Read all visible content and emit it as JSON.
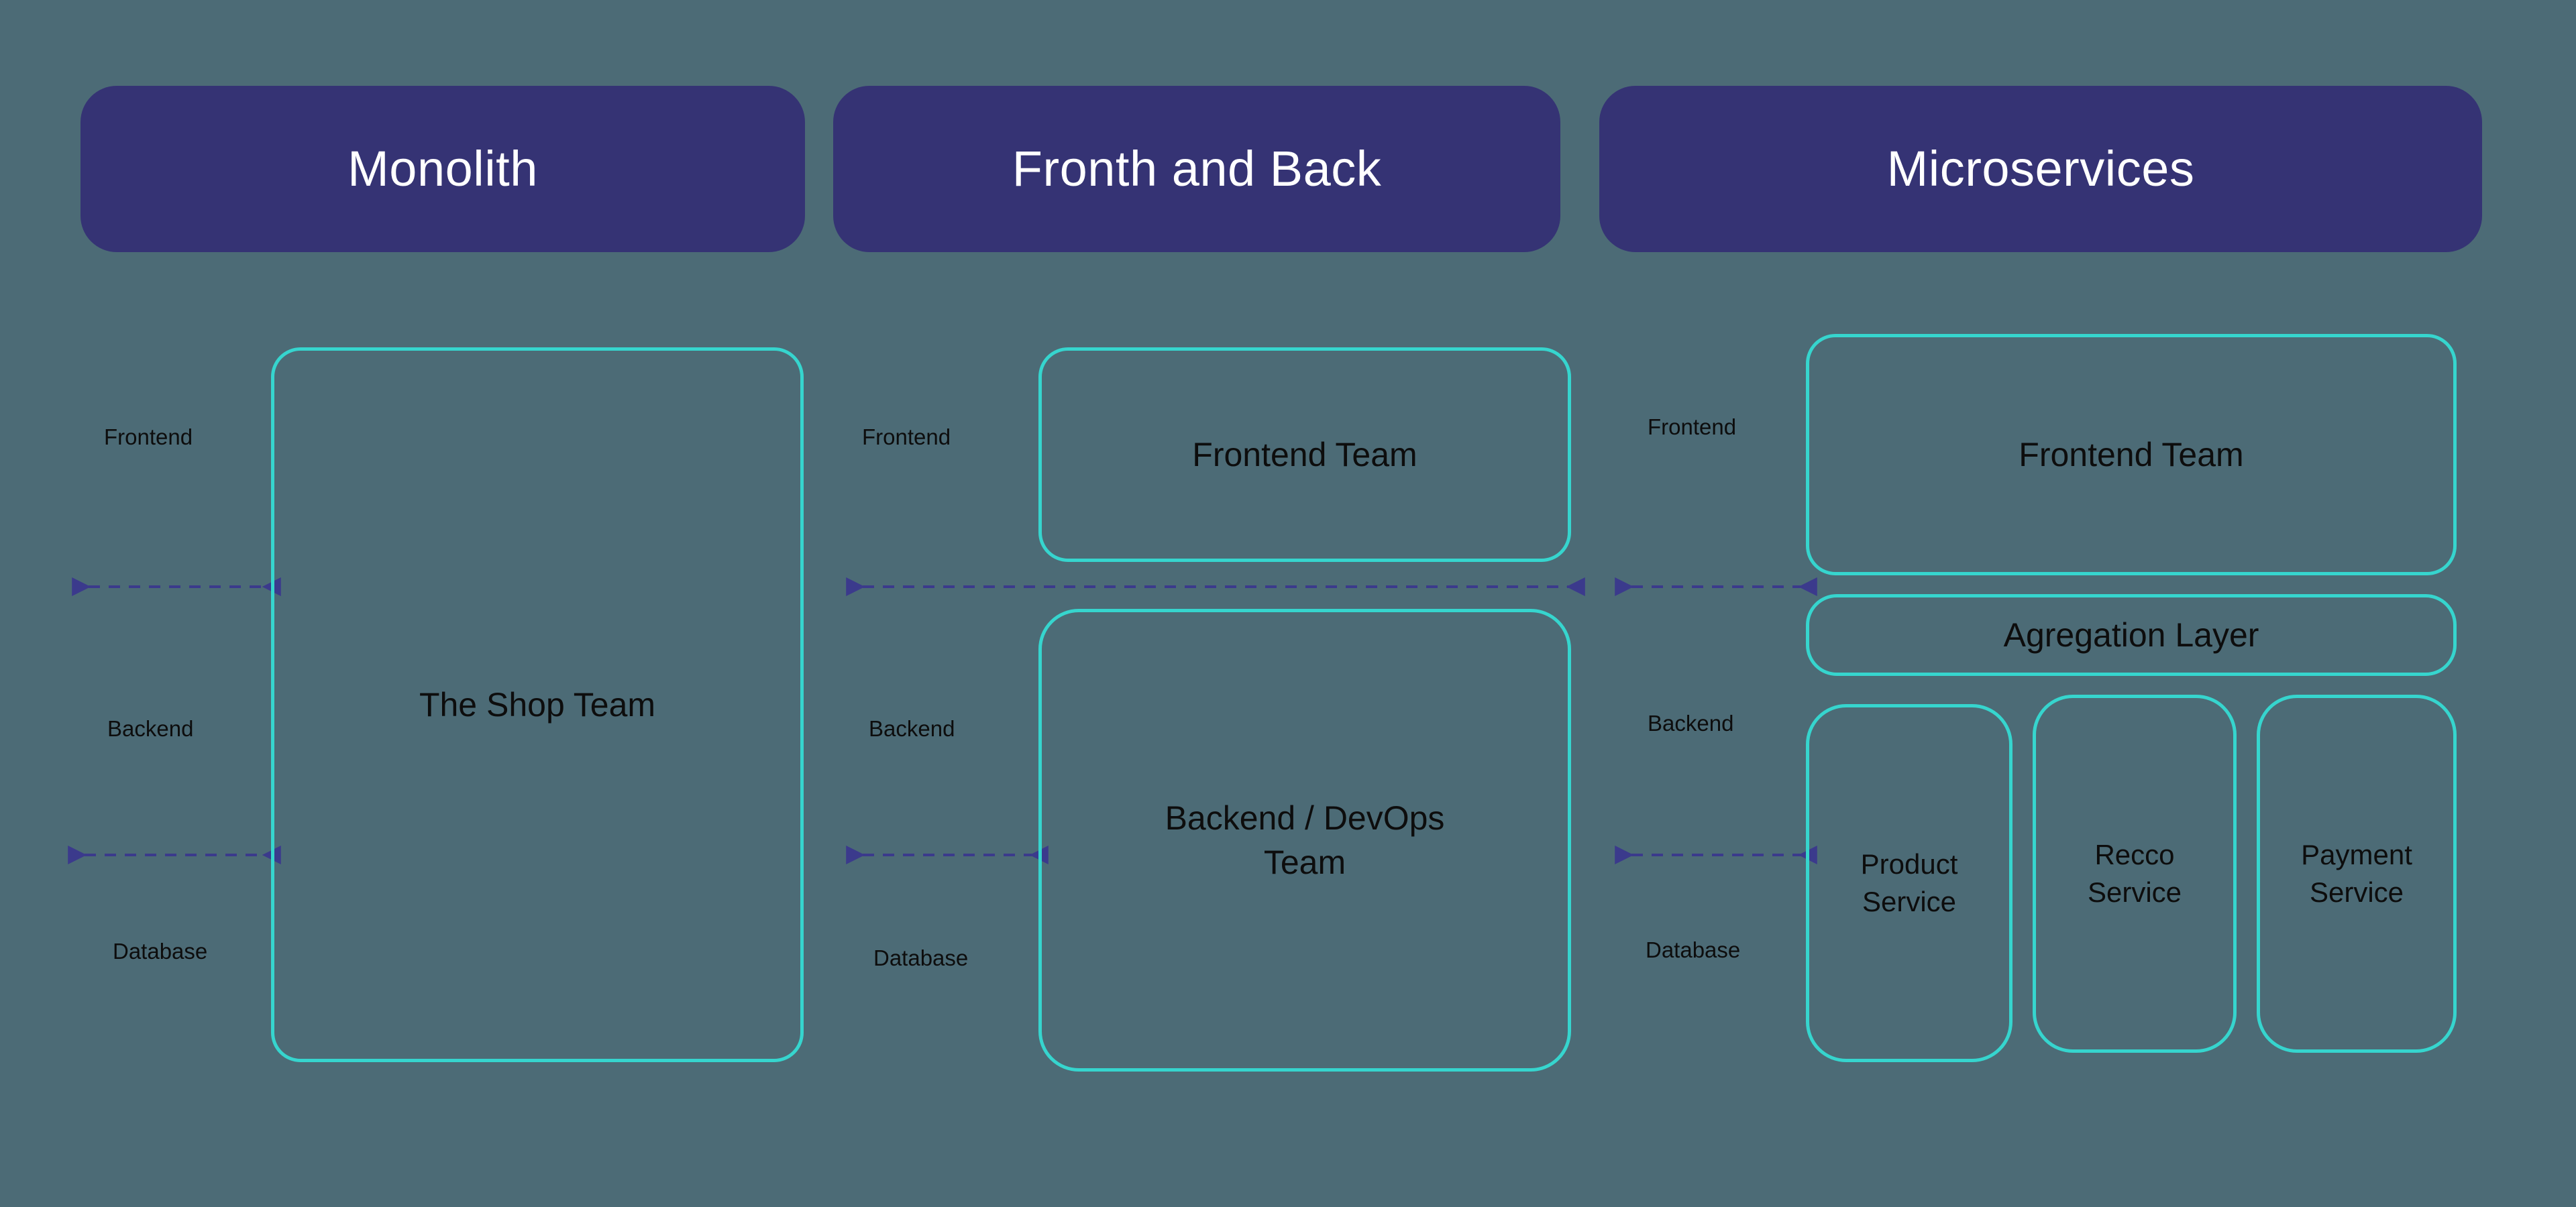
{
  "diagram": {
    "title_bands": [
      {
        "label": "Monolith"
      },
      {
        "label": "Fronth and Back"
      },
      {
        "label": "Microservices"
      }
    ],
    "axis_labels": {
      "frontend": "Frontend",
      "backend": "Backend",
      "database": "Database"
    },
    "columns": [
      {
        "name": "monolith",
        "header": "Monolith",
        "axis": {
          "frontend": "Frontend",
          "backend": "Backend",
          "database": "Database"
        },
        "boxes": [
          {
            "label": "The Shop Team",
            "spans": [
              "frontend",
              "backend",
              "database"
            ]
          }
        ]
      },
      {
        "name": "fronth-and-back",
        "header": "Fronth and Back",
        "axis": {
          "frontend": "Frontend",
          "backend": "Backend",
          "database": "Database"
        },
        "boxes": [
          {
            "label": "Frontend Team",
            "spans": [
              "frontend"
            ]
          },
          {
            "label": "Backend / DevOps Team",
            "spans": [
              "backend",
              "database"
            ]
          }
        ]
      },
      {
        "name": "microservices",
        "header": "Microservices",
        "axis": {
          "frontend": "Frontend",
          "backend": "Backend",
          "database": "Database"
        },
        "boxes": [
          {
            "label": "Frontend Team",
            "spans": [
              "frontend"
            ]
          },
          {
            "label": "Agregation Layer",
            "spans": [
              "boundary"
            ]
          },
          {
            "label": "Product Service",
            "spans": [
              "backend",
              "database"
            ]
          },
          {
            "label": "Recco Service",
            "spans": [
              "backend",
              "database"
            ]
          },
          {
            "label": "Payment Service",
            "spans": [
              "backend",
              "database"
            ]
          }
        ]
      }
    ],
    "connectors": [
      {
        "name": "frontend-backend-divider-col1",
        "style": "dashed-double-arrow"
      },
      {
        "name": "backend-database-divider-col1",
        "style": "dashed-double-arrow"
      },
      {
        "name": "frontend-backend-divider-col2",
        "style": "dashed-double-arrow"
      },
      {
        "name": "backend-database-divider-col2",
        "style": "dashed-double-arrow"
      },
      {
        "name": "frontend-backend-divider-col3",
        "style": "dashed-double-arrow"
      },
      {
        "name": "backend-database-divider-col3",
        "style": "dashed-double-arrow"
      }
    ],
    "colors": {
      "background": "#4c6b76",
      "header_band": "#353374",
      "header_text": "#ffffff",
      "box_border": "#36d5ce",
      "box_text": "#0d0d0d",
      "axis_text": "#0d0d0d",
      "arrow": "#3b3a8c"
    }
  }
}
